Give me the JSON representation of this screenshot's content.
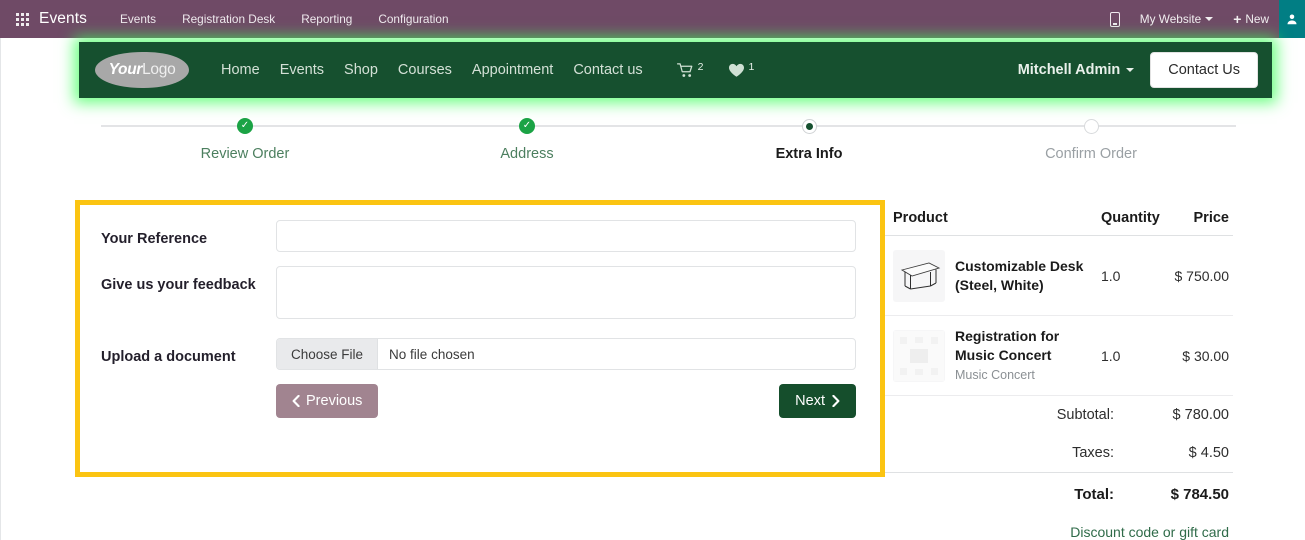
{
  "odoo_bar": {
    "apps_icon": "apps-grid-icon",
    "app_title": "Events",
    "menu": [
      {
        "label": "Events"
      },
      {
        "label": "Registration Desk"
      },
      {
        "label": "Reporting"
      },
      {
        "label": "Configuration"
      }
    ],
    "mobile_icon": "mobile-preview-icon",
    "website_selector": "My Website",
    "new_label": "New",
    "teal_icon": "user-menu-icon",
    "bar_color": "#6f4a66",
    "teal_color": "#017e84"
  },
  "site_nav": {
    "logo_bold": "Your",
    "logo_thin": "Logo",
    "links": [
      {
        "label": "Home"
      },
      {
        "label": "Events"
      },
      {
        "label": "Shop"
      },
      {
        "label": "Courses"
      },
      {
        "label": "Appointment"
      },
      {
        "label": "Contact us"
      }
    ],
    "cart_icon": "shopping-cart-icon",
    "cart_count": "2",
    "wishlist_icon": "heart-icon",
    "wishlist_count": "1",
    "user_name": "Mitchell Admin",
    "contact_button": "Contact Us",
    "nav_color": "#16502f",
    "glow_color": "#3cff5a"
  },
  "stepper": {
    "steps": [
      {
        "label": "Review Order",
        "state": "done"
      },
      {
        "label": "Address",
        "state": "done"
      },
      {
        "label": "Extra Info",
        "state": "active"
      },
      {
        "label": "Confirm Order",
        "state": "todo"
      }
    ],
    "done_color": "#1ba345",
    "active_color": "#16502f"
  },
  "highlight": {
    "color": "#fbc412"
  },
  "form": {
    "reference_label": "Your Reference",
    "reference_value": "",
    "reference_placeholder": "",
    "feedback_label": "Give us your feedback",
    "feedback_value": "",
    "feedback_placeholder": "",
    "upload_label": "Upload a document",
    "choose_file_label": "Choose File",
    "file_status": "No file chosen",
    "previous_button": "Previous",
    "next_button": "Next",
    "prev_icon": "chevron-left-icon",
    "next_icon": "chevron-right-icon",
    "prev_color": "#a18490",
    "next_color": "#154e2c"
  },
  "summary": {
    "headers": {
      "product": "Product",
      "quantity": "Quantity",
      "price": "Price"
    },
    "items": [
      {
        "thumb_icon": "desk-product-image",
        "name": "Customizable Desk (Steel, White)",
        "subtitle": "",
        "quantity": "1.0",
        "price": "$ 750.00"
      },
      {
        "thumb_icon": "event-placeholder-image",
        "name": "Registration for Music Concert",
        "subtitle": "Music Concert",
        "quantity": "1.0",
        "price": "$ 30.00"
      }
    ],
    "subtotal_label": "Subtotal:",
    "subtotal_value": "$ 780.00",
    "taxes_label": "Taxes:",
    "taxes_value": "$ 4.50",
    "total_label": "Total:",
    "total_value": "$ 784.50",
    "discount_link": "Discount code or gift card"
  }
}
